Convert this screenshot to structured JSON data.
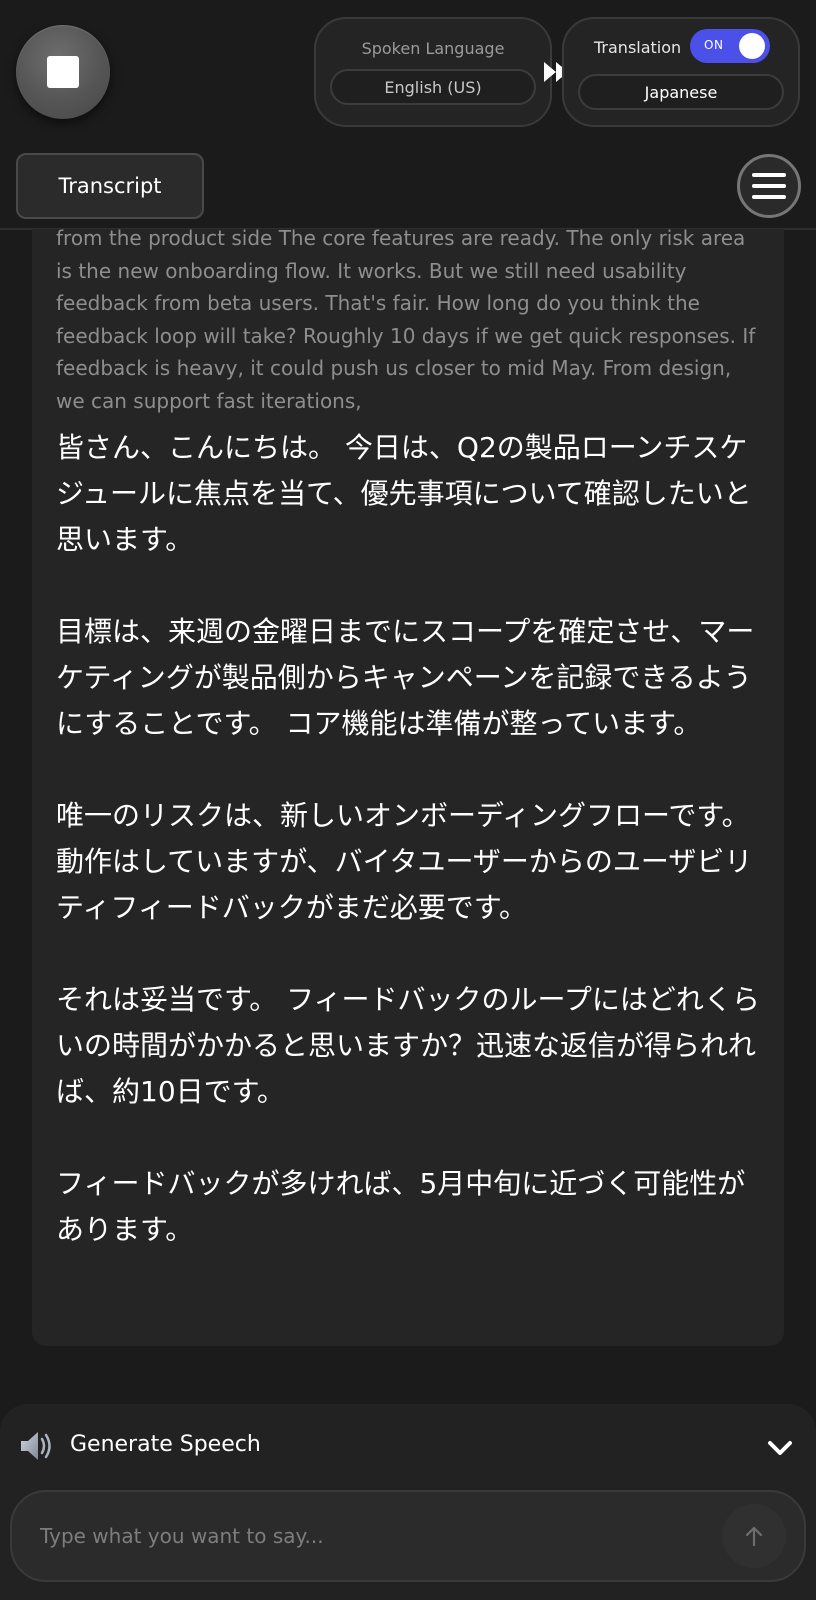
{
  "header": {
    "spoken_language": {
      "title": "Spoken Language",
      "value": "English (US)"
    },
    "translation": {
      "title": "Translation",
      "toggle_label": "ON",
      "enabled": true,
      "value": "Japanese"
    }
  },
  "tabs": {
    "transcript_label": "Transcript"
  },
  "transcript": {
    "source_text": "from the product side The core features are ready. The only risk area is the new onboarding flow. It works. But we still need usability feedback from beta users. That's fair. How long do you think the feedback loop will take? Roughly 10 days if we get quick responses. If feedback is heavy, it could push us closer to mid May. From design, we can support fast iterations,",
    "translation_paragraphs": [
      "皆さん、こんにちは。 今日は、Q2の製品ローンチスケジュールに焦点を当て、優先事項について確認したいと思います。",
      "目標は、来週の金曜日までにスコープを確定させ、マーケティングが製品側からキャンペーンを記録できるようにすることです。 コア機能は準備が整っています。",
      "唯一のリスクは、新しいオンボーディングフローです。 動作はしていますが、バイタユーザーからのユーザビリティフィードバックがまだ必要です。",
      "それは妥当です。 フィードバックのループにはどれくらいの時間がかかると思いますか？迅速な返信が得られれば、約10日です。",
      "フィードバックが多ければ、5月中旬に近づく可能性があります。"
    ]
  },
  "speech_panel": {
    "label": "Generate Speech",
    "input_placeholder": "Type what you want to say...",
    "input_value": ""
  },
  "icons": {
    "stop": "stop-icon",
    "arrow": "fast-forward-icon",
    "menu": "hamburger-menu-icon",
    "speaker": "speaker-icon",
    "chevron": "chevron-down-icon",
    "send": "arrow-up-icon"
  },
  "colors": {
    "background": "#1b1b1c",
    "card": "#252526",
    "accent": "#4a50e8",
    "muted_text": "#8e8e8e"
  }
}
